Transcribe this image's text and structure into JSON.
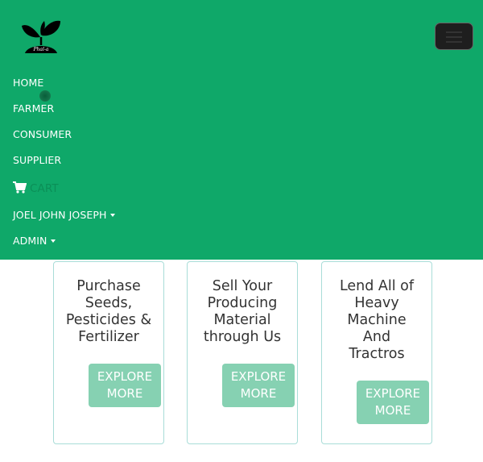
{
  "navbar": {
    "logo_text": "Phal-a",
    "items": [
      {
        "label": "HOME"
      },
      {
        "label": "FARMER"
      },
      {
        "label": "CONSUMER"
      },
      {
        "label": "SUPPLIER"
      },
      {
        "label": "CART",
        "icon": "shopping-cart-icon"
      },
      {
        "label": "JOEL JOHN JOSEPH"
      },
      {
        "label": "ADMIN"
      }
    ],
    "colors": {
      "background": "#0fa869",
      "text": "#ffffff",
      "cart_text": "#0b8f57",
      "toggler": "#1e1e1e"
    }
  },
  "cards": [
    {
      "title": "Purchase Seeds, Pesticides & Fertilizer",
      "button": "EXPLORE MORE"
    },
    {
      "title": "Sell Your Producing Material through Us",
      "button": "EXPLORE MORE"
    },
    {
      "title": "Lend All of Heavy Machine And Tractros",
      "button": "EXPLORE MORE"
    }
  ],
  "card_colors": {
    "border": "#a9ddd8",
    "button": "#86d1b2",
    "title": "#333333"
  }
}
